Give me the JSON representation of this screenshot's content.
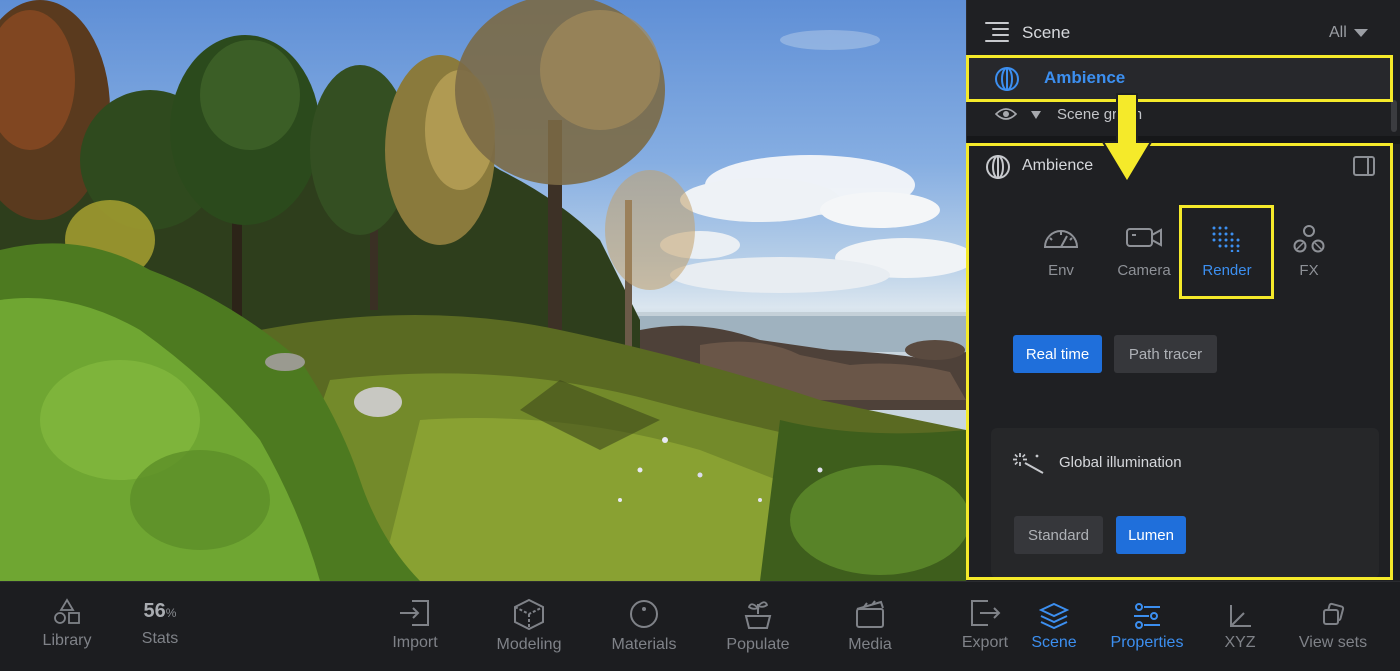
{
  "scene_panel": {
    "title": "Scene",
    "filter": "All",
    "rows": [
      {
        "label": "Ambience",
        "selected": true
      },
      {
        "label": "Scene graph",
        "selected": false
      }
    ]
  },
  "properties": {
    "title": "Ambience",
    "tabs": [
      {
        "label": "Env",
        "icon": "gauge-icon",
        "active": false
      },
      {
        "label": "Camera",
        "icon": "camera-icon",
        "active": false
      },
      {
        "label": "Render",
        "icon": "render-grid-icon",
        "active": true
      },
      {
        "label": "FX",
        "icon": "fx-circles-icon",
        "active": false
      }
    ],
    "render_modes": [
      {
        "label": "Real time",
        "active": true
      },
      {
        "label": "Path tracer",
        "active": false
      }
    ],
    "global_illumination": {
      "title": "Global illumination",
      "options": [
        {
          "label": "Standard",
          "active": false
        },
        {
          "label": "Lumen",
          "active": true
        }
      ]
    }
  },
  "toolbar": {
    "library": "Library",
    "stats_value": "56",
    "stats_unit": "%",
    "stats": "Stats",
    "import": "Import",
    "modeling": "Modeling",
    "materials": "Materials",
    "populate": "Populate",
    "media": "Media",
    "export": "Export",
    "scene": "Scene",
    "properties": "Properties",
    "xyz": "XYZ",
    "view_sets": "View sets"
  },
  "colors": {
    "accent": "#3c8ff0",
    "primary_button": "#1f6fdb",
    "highlight": "#f5ea2a",
    "panel_bg": "#1f2023"
  }
}
